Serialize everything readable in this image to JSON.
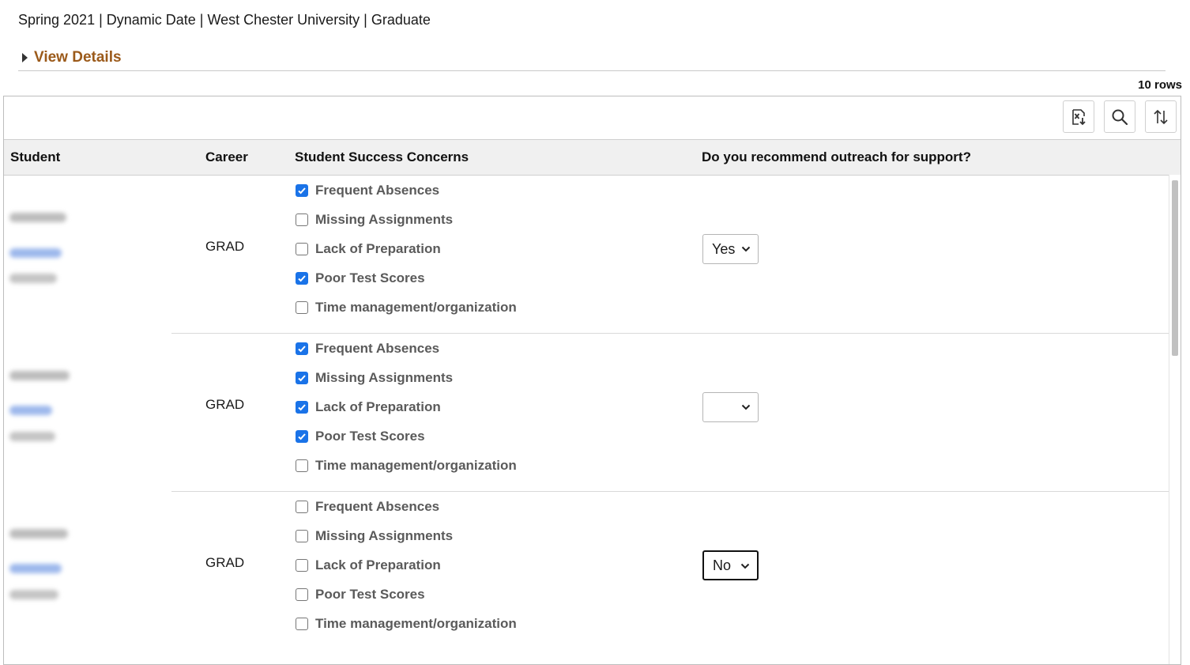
{
  "context": {
    "text": "Spring 2021 | Dynamic Date | West Chester University | Graduate"
  },
  "view_details": {
    "label": "View Details"
  },
  "grid": {
    "row_count": "10 rows",
    "toolbar": {
      "export_icon": "excel-export-icon",
      "search_icon": "search-icon",
      "sort_icon": "sort-icon"
    },
    "columns": [
      "Student",
      "Career",
      "Student Success Concerns",
      "Do you recommend outreach for support?"
    ],
    "concern_labels": [
      "Frequent Absences",
      "Missing Assignments",
      "Lack of Preparation",
      "Poor Test Scores",
      "Time management/organization"
    ],
    "rows": [
      {
        "career": "GRAD",
        "concerns": [
          true,
          false,
          false,
          true,
          false
        ],
        "outreach": "Yes"
      },
      {
        "career": "GRAD",
        "concerns": [
          true,
          true,
          true,
          true,
          false
        ],
        "outreach": ""
      },
      {
        "career": "GRAD",
        "concerns": [
          false,
          false,
          false,
          false,
          false
        ],
        "outreach": "No"
      }
    ]
  },
  "colors": {
    "accent_link": "#9b5a1a",
    "checkbox_checked": "#1a73e8",
    "header_bg": "#f0f0f0"
  }
}
